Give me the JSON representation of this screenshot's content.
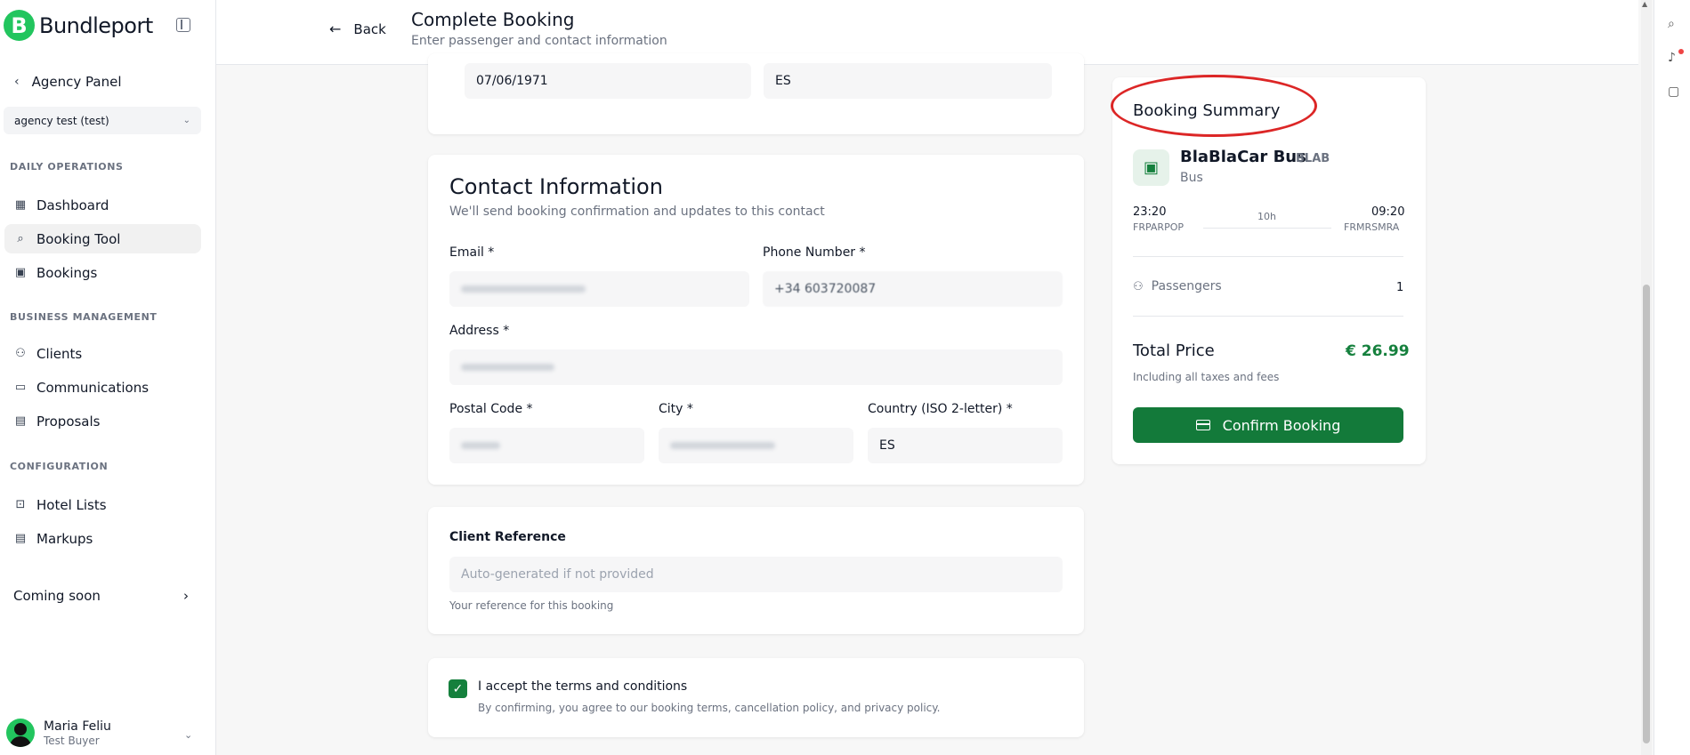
{
  "app": {
    "brand": "Bundleport",
    "logo_letter": "B"
  },
  "sidebar": {
    "back_label": "Agency Panel",
    "agency_select": "agency test (test)",
    "sections": {
      "daily": "DAILY OPERATIONS",
      "business": "BUSINESS MANAGEMENT",
      "config": "CONFIGURATION"
    },
    "items": {
      "dashboard": "Dashboard",
      "booking_tool": "Booking Tool",
      "bookings": "Bookings",
      "clients": "Clients",
      "communications": "Communications",
      "proposals": "Proposals",
      "hotel_lists": "Hotel Lists",
      "markups": "Markups"
    },
    "coming_soon": "Coming soon",
    "user": {
      "name": "Maria Feliu",
      "role": "Test Buyer"
    }
  },
  "header": {
    "back": "Back",
    "title": "Complete Booking",
    "subtitle": "Enter passenger and contact information"
  },
  "passenger": {
    "birth_date": "07/06/1971",
    "nationality": "ES"
  },
  "contact": {
    "title": "Contact Information",
    "subtitle": "We'll send booking confirmation and updates to this contact",
    "email_label": "Email *",
    "phone_label": "Phone Number *",
    "phone_value": "+34 603720087",
    "address_label": "Address *",
    "postal_label": "Postal Code *",
    "city_label": "City *",
    "country_label": "Country (ISO 2-letter) *",
    "country_value": "ES"
  },
  "client_ref": {
    "label": "Client Reference",
    "placeholder": "Auto-generated if not provided",
    "help": "Your reference for this booking"
  },
  "terms": {
    "label": "I accept the terms and conditions",
    "detail": "By confirming, you agree to our booking terms, cancellation policy, and privacy policy."
  },
  "summary": {
    "title": "Booking Summary",
    "carrier": "BlaBlaCar Bus",
    "carrier_code": "BLAB",
    "type": "Bus",
    "depart_time": "23:20",
    "arrive_time": "09:20",
    "origin": "FRPARPOP",
    "destination": "FRMRSMRA",
    "duration": "10h",
    "passengers_label": "Passengers",
    "passengers_count": "1",
    "total_label": "Total Price",
    "total_value": "€ 26.99",
    "taxes_note": "Including all taxes and fees",
    "confirm": "Confirm Booking"
  },
  "colors": {
    "brand": "#22c55e",
    "primary": "#137a3a",
    "price": "#15803d",
    "annotation": "#dc2626"
  }
}
